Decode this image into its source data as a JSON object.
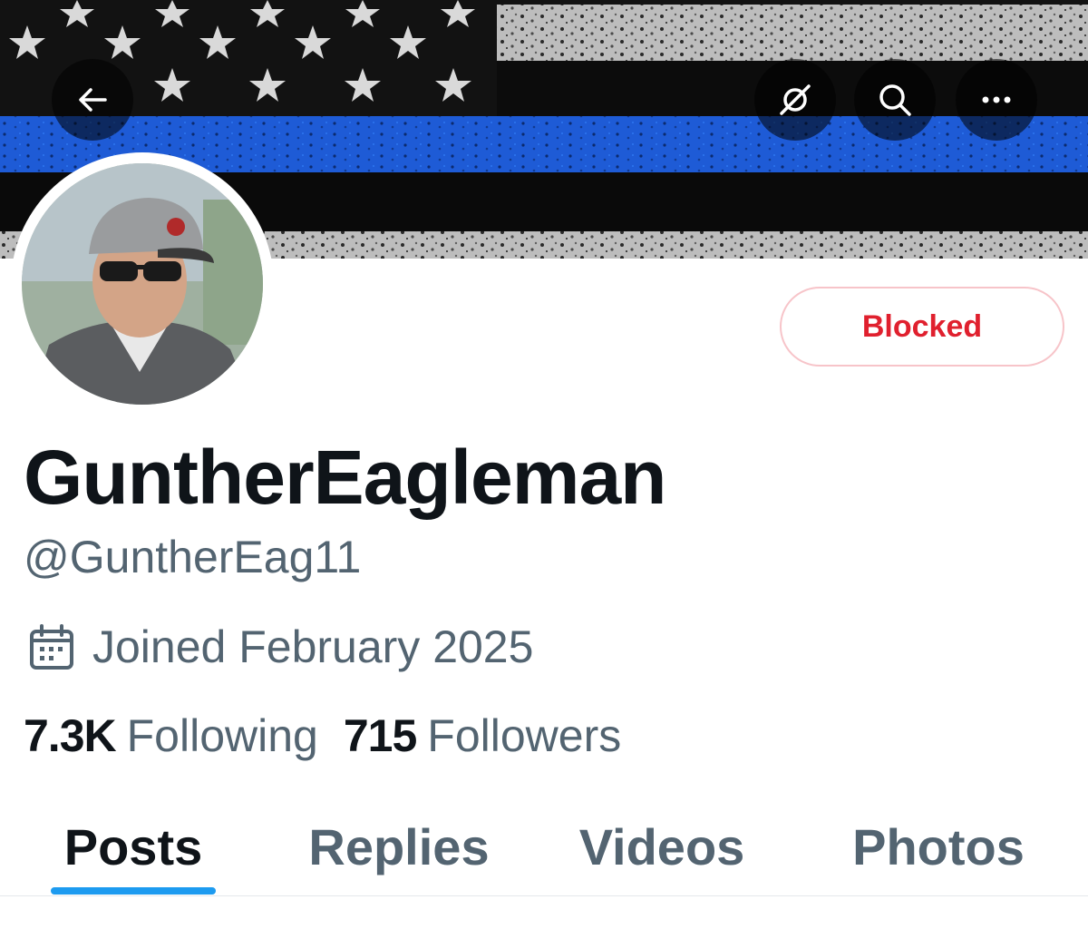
{
  "header": {
    "back_icon": "arrow-left-icon",
    "grok_icon": "grok-icon",
    "search_icon": "search-icon",
    "more_icon": "more-horizontal-icon"
  },
  "profile": {
    "display_name": "GuntherEagleman",
    "handle": "@GuntherEag11",
    "joined": "Joined February 2025",
    "joined_icon": "calendar-icon",
    "following_count": "7.3K",
    "following_label": "Following",
    "followers_count": "715",
    "followers_label": "Followers",
    "blocked_label": "Blocked"
  },
  "tabs": [
    {
      "label": "Posts",
      "active": true
    },
    {
      "label": "Replies",
      "active": false
    },
    {
      "label": "Videos",
      "active": false
    },
    {
      "label": "Photos",
      "active": false
    }
  ],
  "colors": {
    "accent": "#1d9bf0",
    "blocked_red": "#e0202e",
    "blocked_border": "#f7c4c9",
    "secondary_text": "#536471",
    "primary_text": "#0f1419",
    "banner_blue_line": "#1e5bd6"
  }
}
